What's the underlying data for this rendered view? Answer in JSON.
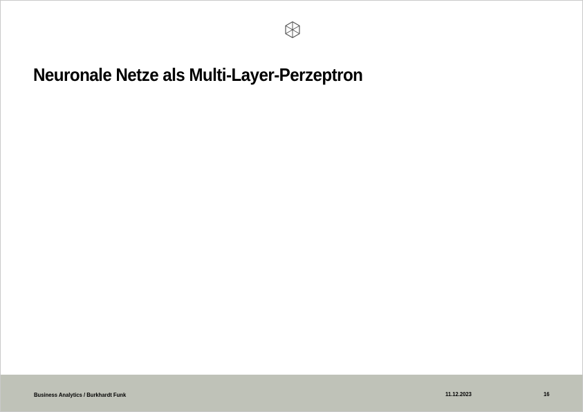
{
  "slide": {
    "title": "Neuronale Netze als Multi-Layer-Perzeptron",
    "logo_icon": "hexagon-cube-icon"
  },
  "footer": {
    "course_author": "Business Analytics / Burkhardt Funk",
    "date": "11.12.2023",
    "page_number": "16"
  },
  "colors": {
    "footer_background": "#bfc2b8",
    "title_text": "#000000",
    "logo_stroke": "#555555"
  }
}
